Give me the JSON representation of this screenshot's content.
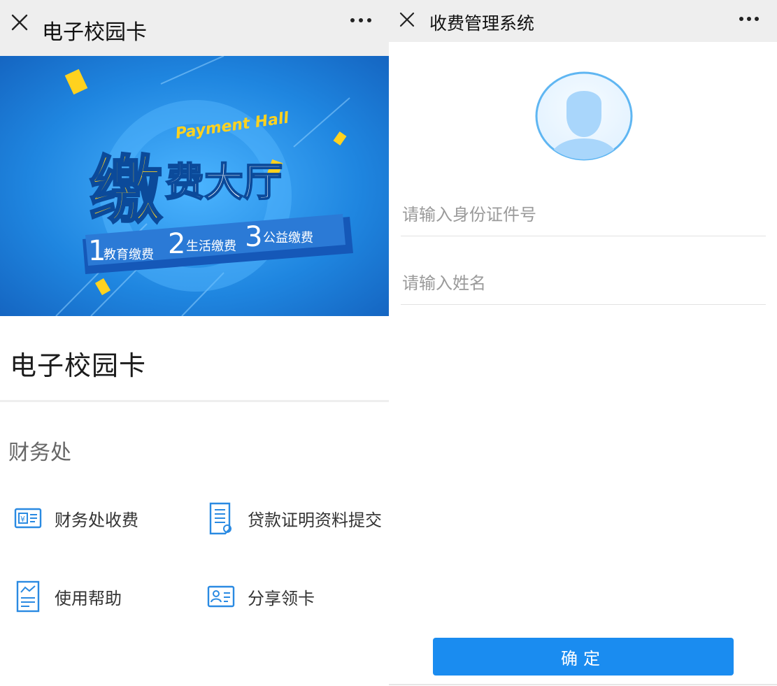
{
  "left": {
    "topbar": {
      "title": "电子校园卡"
    },
    "banner": {
      "headline_big": "缴",
      "headline_rest": "费大厅",
      "english": "Payment Hall",
      "ribbon": [
        {
          "num": "1",
          "text": "教育缴费"
        },
        {
          "num": "2",
          "text": "生活缴费"
        },
        {
          "num": "3",
          "text": "公益缴费"
        }
      ]
    },
    "card_title": "电子校园卡",
    "section_label": "财务处",
    "services": [
      {
        "label": "财务处收费",
        "icon": "yuan-card-icon"
      },
      {
        "label": "贷款证明资料提交",
        "icon": "document-icon"
      },
      {
        "label": "使用帮助",
        "icon": "help-document-icon"
      },
      {
        "label": "分享领卡",
        "icon": "id-card-icon"
      }
    ]
  },
  "right": {
    "topbar": {
      "title": "收费管理系统"
    },
    "form": {
      "id_placeholder": "请输入身份证件号",
      "name_placeholder": "请输入姓名",
      "confirm_label": "确定"
    }
  },
  "colors": {
    "accent": "#1a8cf0",
    "banner_blue": "#1f86e0",
    "banner_yellow": "#ffd21f",
    "icon_blue": "#2a8ae2"
  }
}
